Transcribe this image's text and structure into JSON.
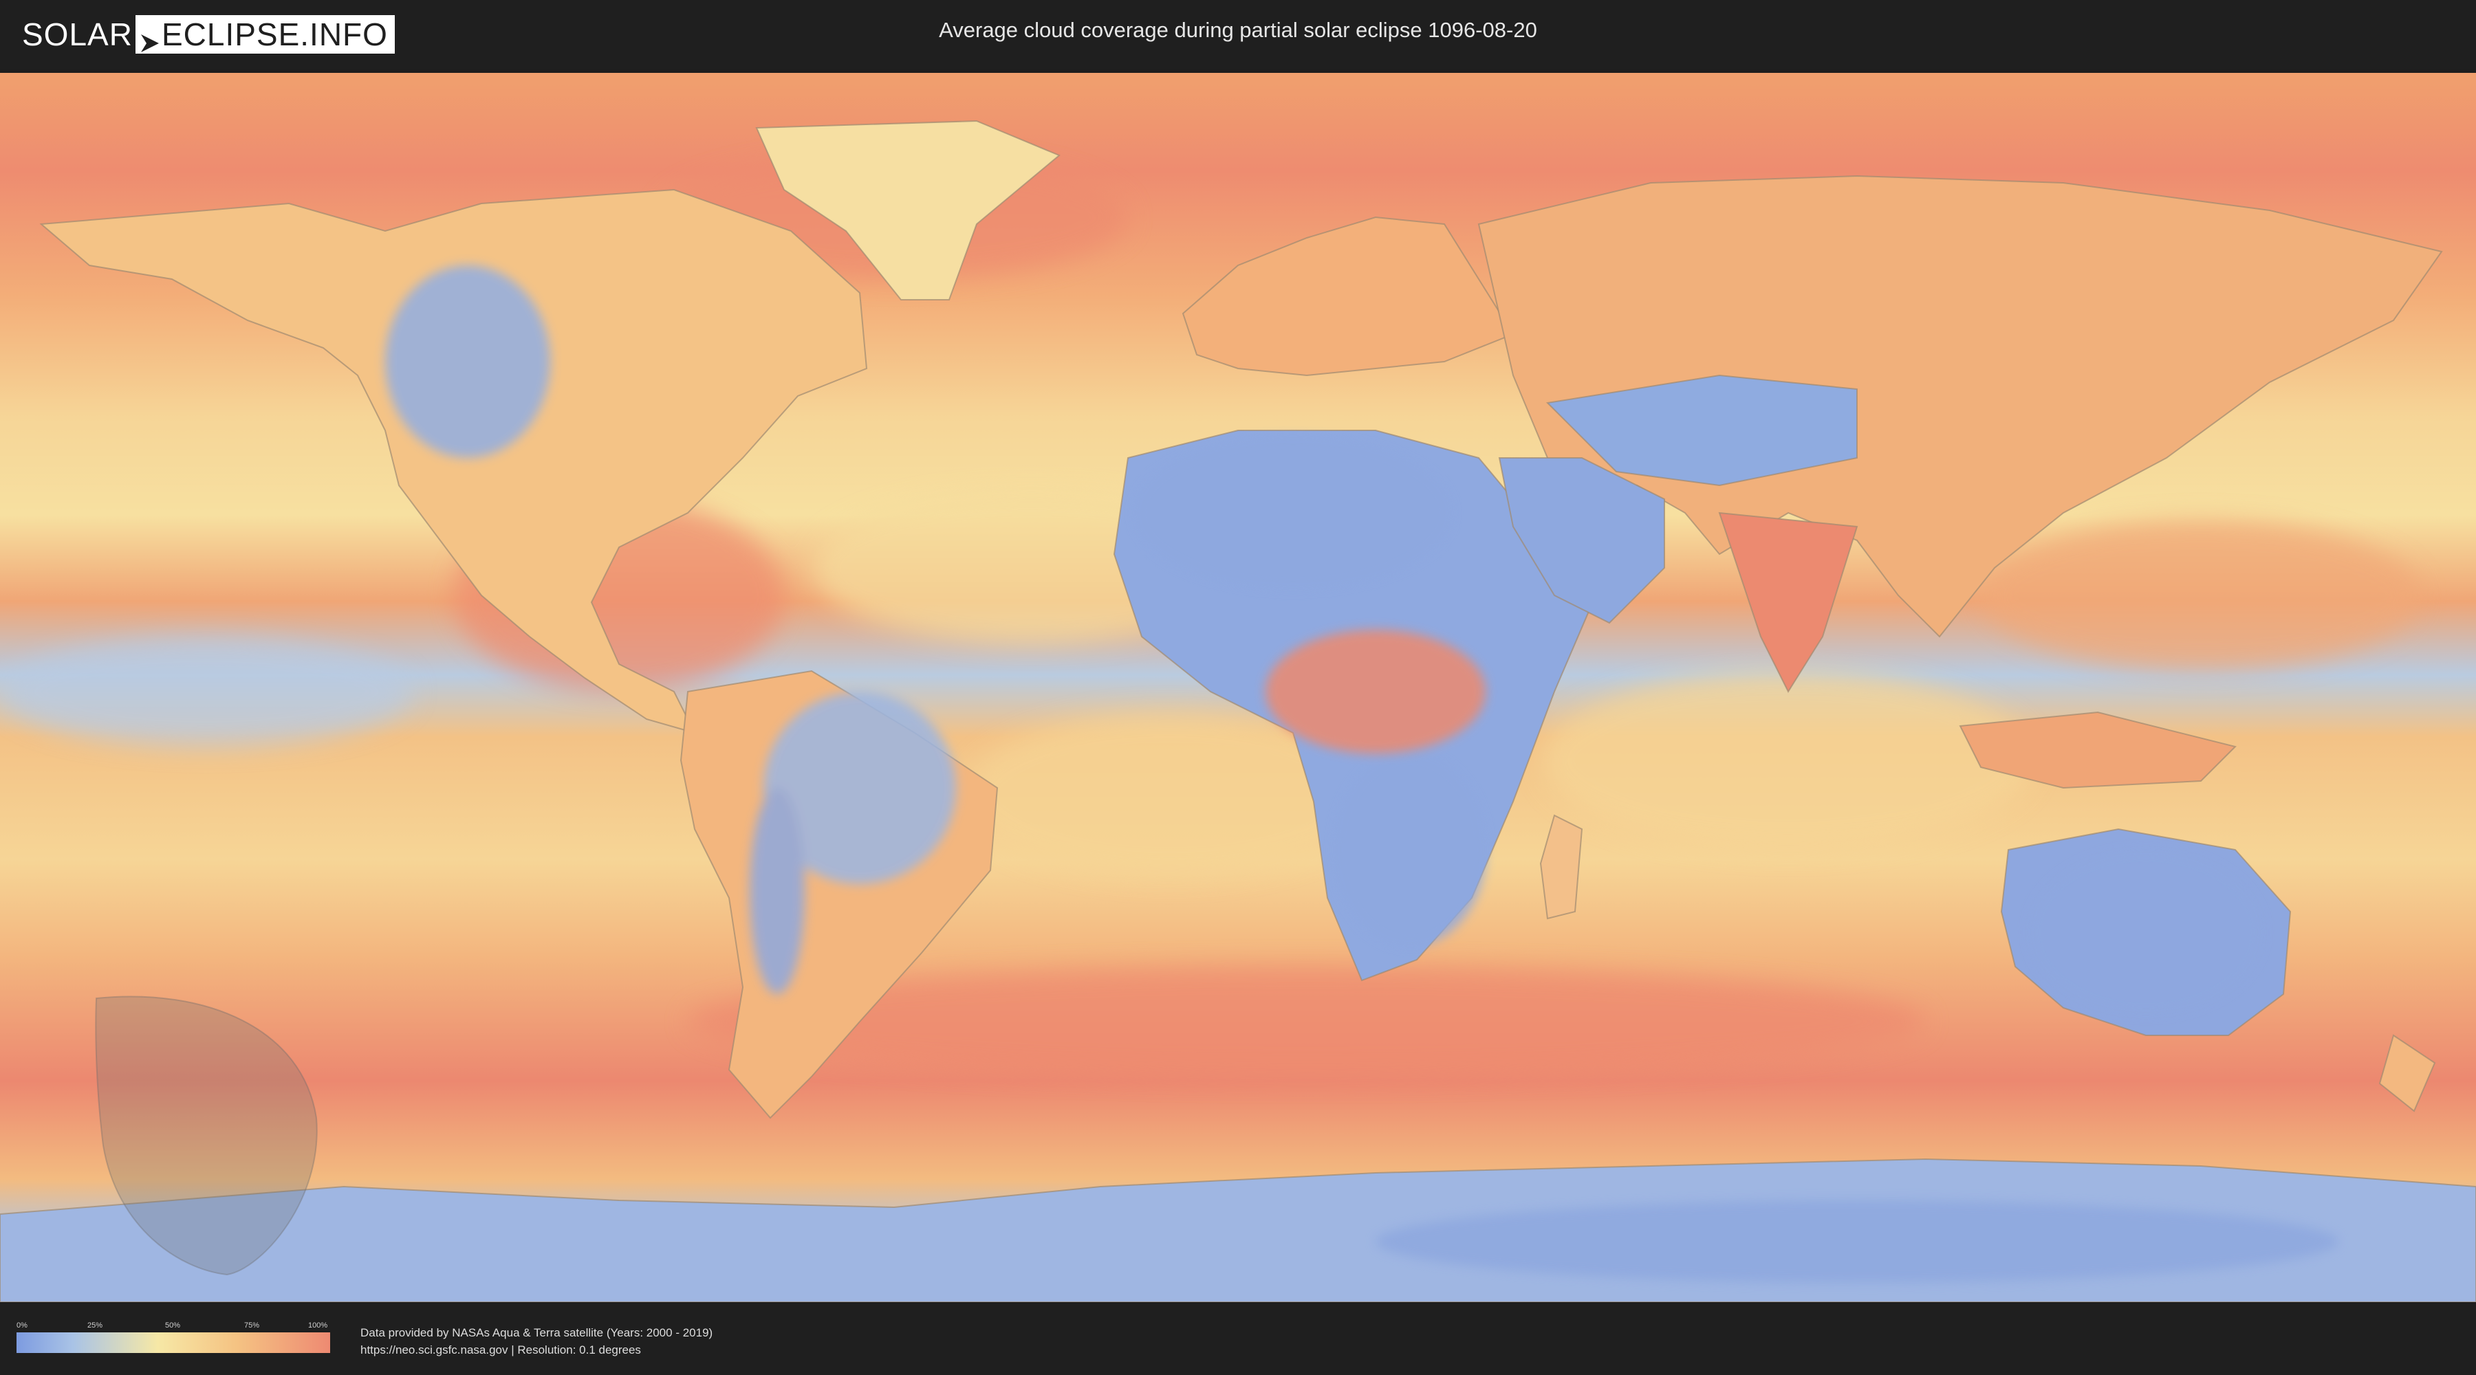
{
  "header": {
    "logo_left": "SOLAR",
    "logo_right": "ECLIPSE.INFO",
    "title": "Average cloud coverage during partial solar eclipse 1096-08-20"
  },
  "map": {
    "icon": "world-cloud-map",
    "colors": {
      "clear": "#7d9be0",
      "low": "#a9c3e6",
      "mid": "#f6e8a6",
      "high": "#f5c383",
      "overcast": "#ee8a72"
    }
  },
  "legend": {
    "ticks": [
      "0%",
      "25%",
      "50%",
      "75%",
      "100%"
    ]
  },
  "footer": {
    "credit_line1": "Data provided by NASAs Aqua & Terra satellite (Years: 2000 - 2019)",
    "credit_line2": "https://neo.sci.gsfc.nasa.gov | Resolution: 0.1 degrees"
  }
}
